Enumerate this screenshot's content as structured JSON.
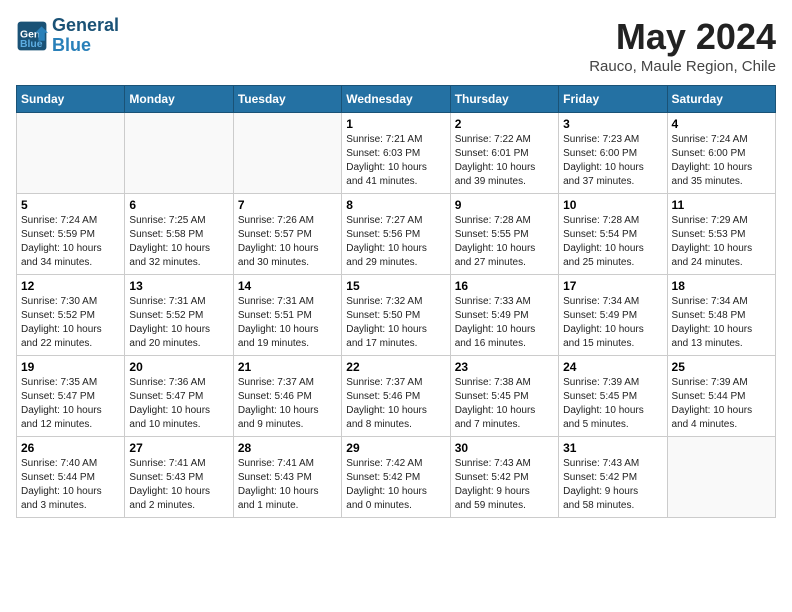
{
  "header": {
    "logo_line1": "General",
    "logo_line2": "Blue",
    "month_title": "May 2024",
    "location": "Rauco, Maule Region, Chile"
  },
  "days_of_week": [
    "Sunday",
    "Monday",
    "Tuesday",
    "Wednesday",
    "Thursday",
    "Friday",
    "Saturday"
  ],
  "weeks": [
    [
      {
        "day": "",
        "info": ""
      },
      {
        "day": "",
        "info": ""
      },
      {
        "day": "",
        "info": ""
      },
      {
        "day": "1",
        "info": "Sunrise: 7:21 AM\nSunset: 6:03 PM\nDaylight: 10 hours\nand 41 minutes."
      },
      {
        "day": "2",
        "info": "Sunrise: 7:22 AM\nSunset: 6:01 PM\nDaylight: 10 hours\nand 39 minutes."
      },
      {
        "day": "3",
        "info": "Sunrise: 7:23 AM\nSunset: 6:00 PM\nDaylight: 10 hours\nand 37 minutes."
      },
      {
        "day": "4",
        "info": "Sunrise: 7:24 AM\nSunset: 6:00 PM\nDaylight: 10 hours\nand 35 minutes."
      }
    ],
    [
      {
        "day": "5",
        "info": "Sunrise: 7:24 AM\nSunset: 5:59 PM\nDaylight: 10 hours\nand 34 minutes."
      },
      {
        "day": "6",
        "info": "Sunrise: 7:25 AM\nSunset: 5:58 PM\nDaylight: 10 hours\nand 32 minutes."
      },
      {
        "day": "7",
        "info": "Sunrise: 7:26 AM\nSunset: 5:57 PM\nDaylight: 10 hours\nand 30 minutes."
      },
      {
        "day": "8",
        "info": "Sunrise: 7:27 AM\nSunset: 5:56 PM\nDaylight: 10 hours\nand 29 minutes."
      },
      {
        "day": "9",
        "info": "Sunrise: 7:28 AM\nSunset: 5:55 PM\nDaylight: 10 hours\nand 27 minutes."
      },
      {
        "day": "10",
        "info": "Sunrise: 7:28 AM\nSunset: 5:54 PM\nDaylight: 10 hours\nand 25 minutes."
      },
      {
        "day": "11",
        "info": "Sunrise: 7:29 AM\nSunset: 5:53 PM\nDaylight: 10 hours\nand 24 minutes."
      }
    ],
    [
      {
        "day": "12",
        "info": "Sunrise: 7:30 AM\nSunset: 5:52 PM\nDaylight: 10 hours\nand 22 minutes."
      },
      {
        "day": "13",
        "info": "Sunrise: 7:31 AM\nSunset: 5:52 PM\nDaylight: 10 hours\nand 20 minutes."
      },
      {
        "day": "14",
        "info": "Sunrise: 7:31 AM\nSunset: 5:51 PM\nDaylight: 10 hours\nand 19 minutes."
      },
      {
        "day": "15",
        "info": "Sunrise: 7:32 AM\nSunset: 5:50 PM\nDaylight: 10 hours\nand 17 minutes."
      },
      {
        "day": "16",
        "info": "Sunrise: 7:33 AM\nSunset: 5:49 PM\nDaylight: 10 hours\nand 16 minutes."
      },
      {
        "day": "17",
        "info": "Sunrise: 7:34 AM\nSunset: 5:49 PM\nDaylight: 10 hours\nand 15 minutes."
      },
      {
        "day": "18",
        "info": "Sunrise: 7:34 AM\nSunset: 5:48 PM\nDaylight: 10 hours\nand 13 minutes."
      }
    ],
    [
      {
        "day": "19",
        "info": "Sunrise: 7:35 AM\nSunset: 5:47 PM\nDaylight: 10 hours\nand 12 minutes."
      },
      {
        "day": "20",
        "info": "Sunrise: 7:36 AM\nSunset: 5:47 PM\nDaylight: 10 hours\nand 10 minutes."
      },
      {
        "day": "21",
        "info": "Sunrise: 7:37 AM\nSunset: 5:46 PM\nDaylight: 10 hours\nand 9 minutes."
      },
      {
        "day": "22",
        "info": "Sunrise: 7:37 AM\nSunset: 5:46 PM\nDaylight: 10 hours\nand 8 minutes."
      },
      {
        "day": "23",
        "info": "Sunrise: 7:38 AM\nSunset: 5:45 PM\nDaylight: 10 hours\nand 7 minutes."
      },
      {
        "day": "24",
        "info": "Sunrise: 7:39 AM\nSunset: 5:45 PM\nDaylight: 10 hours\nand 5 minutes."
      },
      {
        "day": "25",
        "info": "Sunrise: 7:39 AM\nSunset: 5:44 PM\nDaylight: 10 hours\nand 4 minutes."
      }
    ],
    [
      {
        "day": "26",
        "info": "Sunrise: 7:40 AM\nSunset: 5:44 PM\nDaylight: 10 hours\nand 3 minutes."
      },
      {
        "day": "27",
        "info": "Sunrise: 7:41 AM\nSunset: 5:43 PM\nDaylight: 10 hours\nand 2 minutes."
      },
      {
        "day": "28",
        "info": "Sunrise: 7:41 AM\nSunset: 5:43 PM\nDaylight: 10 hours\nand 1 minute."
      },
      {
        "day": "29",
        "info": "Sunrise: 7:42 AM\nSunset: 5:42 PM\nDaylight: 10 hours\nand 0 minutes."
      },
      {
        "day": "30",
        "info": "Sunrise: 7:43 AM\nSunset: 5:42 PM\nDaylight: 9 hours\nand 59 minutes."
      },
      {
        "day": "31",
        "info": "Sunrise: 7:43 AM\nSunset: 5:42 PM\nDaylight: 9 hours\nand 58 minutes."
      },
      {
        "day": "",
        "info": ""
      }
    ]
  ]
}
